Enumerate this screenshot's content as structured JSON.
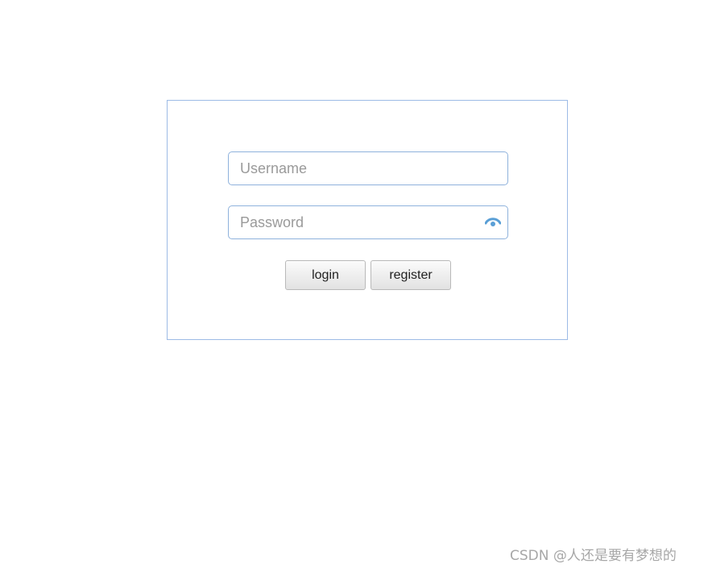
{
  "login_form": {
    "username": {
      "placeholder": "Username",
      "value": ""
    },
    "password": {
      "placeholder": "Password",
      "value": "",
      "toggle_icon": "eye-icon"
    },
    "buttons": {
      "login_label": "login",
      "register_label": "register"
    }
  },
  "colors": {
    "border": "#9dbbe6",
    "input_border": "#8fb2dc",
    "eye_icon": "#5a9fd6",
    "placeholder": "#9a9a9a"
  },
  "watermark": {
    "text": "CSDN @人还是要有梦想的"
  }
}
